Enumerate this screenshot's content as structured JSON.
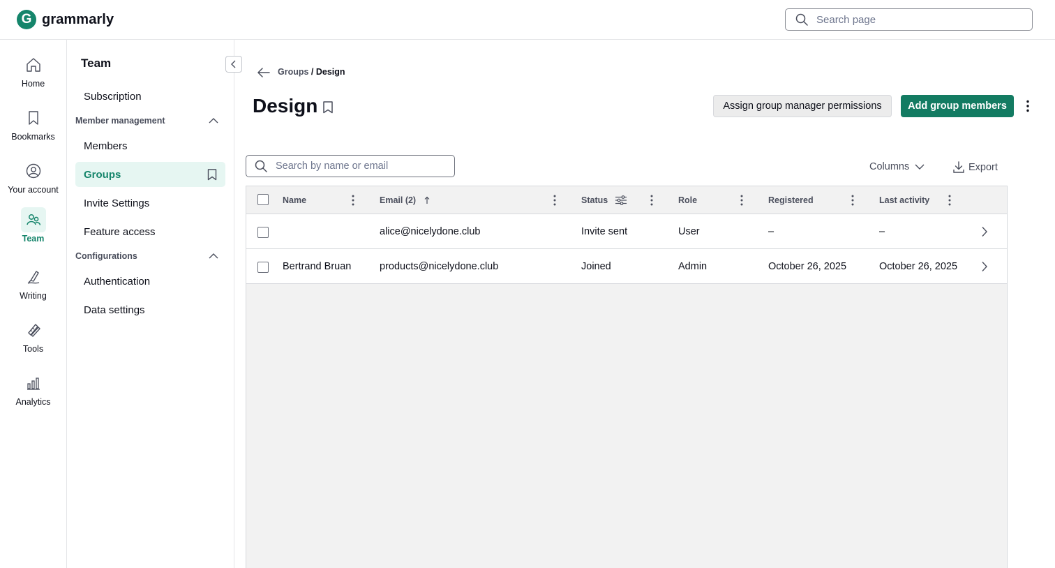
{
  "brand": {
    "logo_letter": "G",
    "name": "grammarly"
  },
  "top_search": {
    "placeholder": "Search page"
  },
  "rail": [
    {
      "label": "Home",
      "icon": "home-icon"
    },
    {
      "label": "Bookmarks",
      "icon": "bookmark-icon"
    },
    {
      "label": "Your account",
      "icon": "account-icon"
    },
    {
      "label": "Team",
      "icon": "team-icon",
      "active": true
    },
    {
      "label": "Writing",
      "icon": "pen-icon"
    },
    {
      "label": "Tools",
      "icon": "tools-icon"
    },
    {
      "label": "Analytics",
      "icon": "analytics-icon"
    }
  ],
  "sidebar": {
    "title": "Team",
    "subscription": "Subscription",
    "member_management": "Member management",
    "members": "Members",
    "groups": "Groups",
    "invite_settings": "Invite Settings",
    "feature_access": "Feature access",
    "configurations": "Configurations",
    "authentication": "Authentication",
    "data_settings": "Data settings"
  },
  "breadcrumb": {
    "parent": "Groups",
    "separator": " / ",
    "current": "Design"
  },
  "page": {
    "title": "Design",
    "assign_label": "Assign group manager permissions",
    "add_label": "Add group members"
  },
  "table_tools": {
    "search_placeholder": "Search by name or email",
    "columns_label": "Columns",
    "export_label": "Export"
  },
  "table": {
    "headers": {
      "name": "Name",
      "email": "Email (2)",
      "status": "Status",
      "role": "Role",
      "registered": "Registered",
      "last_activity": "Last activity"
    },
    "rows": [
      {
        "name": "",
        "email": "alice@nicelydone.club",
        "status": "Invite sent",
        "role": "User",
        "registered": "–",
        "last_activity": "–"
      },
      {
        "name": "Bertrand Bruan",
        "email": "products@nicelydone.club",
        "status": "Joined",
        "role": "Admin",
        "registered": "October 26, 2025",
        "last_activity": "October 26, 2025"
      }
    ]
  },
  "colors": {
    "accent": "#15856b",
    "accent_bg": "#e6f6f2",
    "button_primary": "#137b62"
  }
}
